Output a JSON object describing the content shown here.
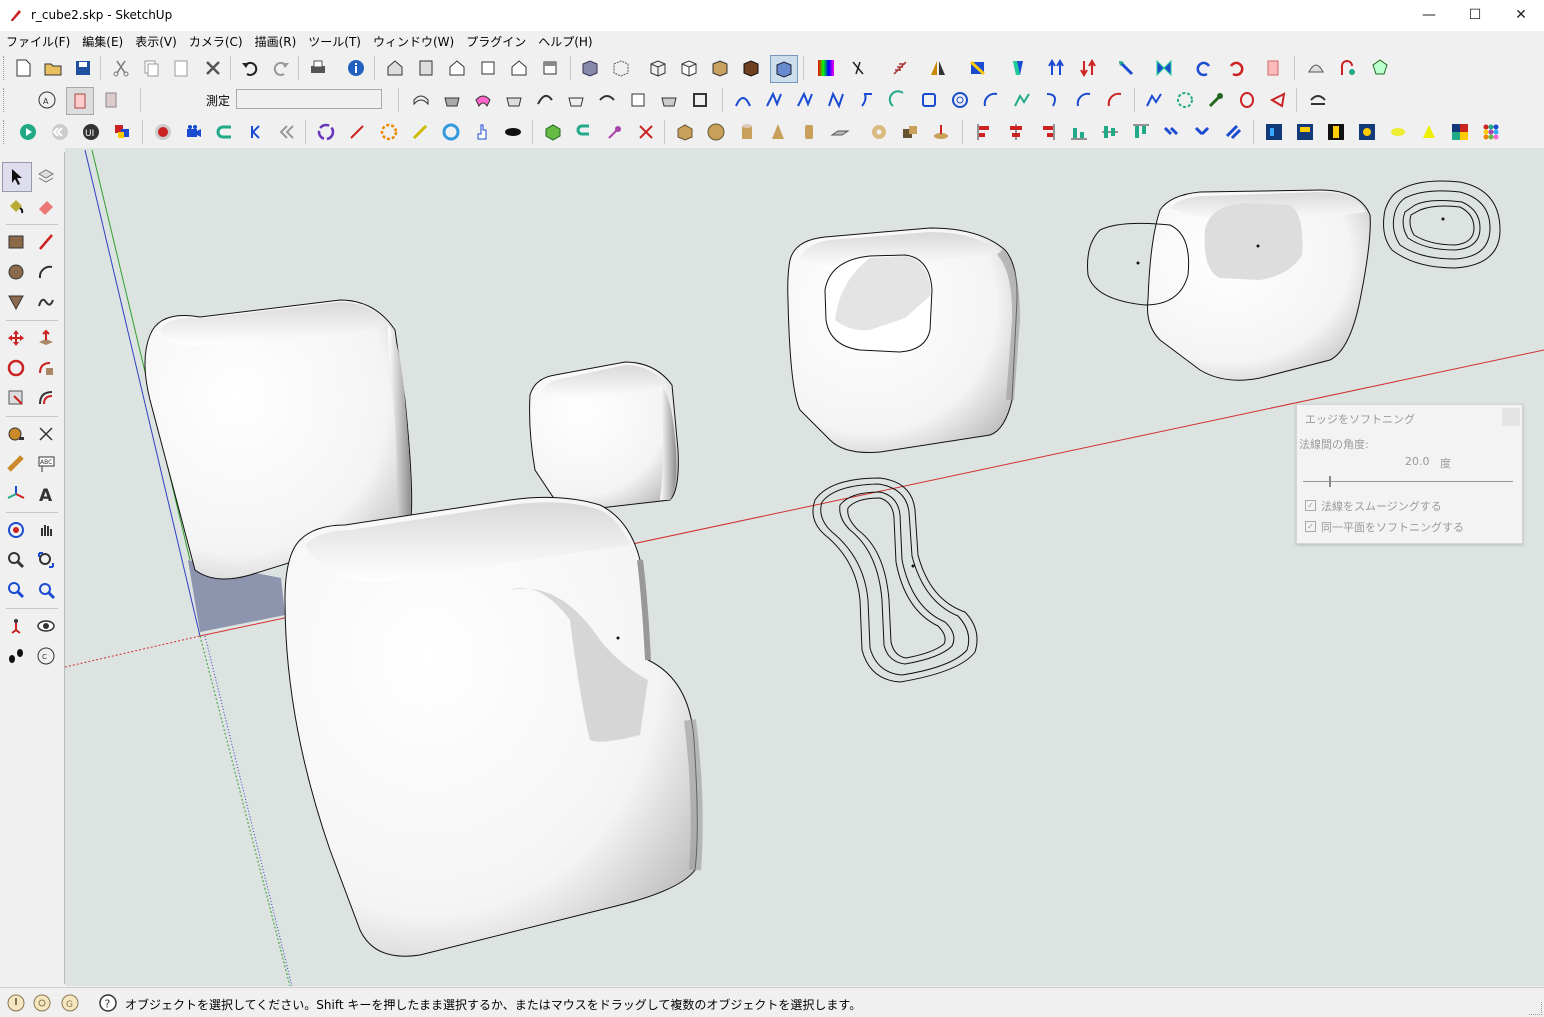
{
  "window": {
    "title": "r_cube2.skp - SketchUp",
    "minimize": "—",
    "maximize": "☐",
    "close": "✕"
  },
  "menu": [
    "ファイル(F)",
    "編集(E)",
    "表示(V)",
    "カメラ(C)",
    "描画(R)",
    "ツール(T)",
    "ウィンドウ(W)",
    "プラグイン",
    "ヘルプ(H)"
  ],
  "measure": {
    "label": "測定",
    "value": ""
  },
  "dialog": {
    "title": "エッジをソフトニング",
    "angle_label": "法線間の角度:",
    "angle_value": "20.0",
    "angle_unit": "度",
    "option1": "法線をスムージングする",
    "option2": "同一平面をソフトニングする",
    "option1_checked": true,
    "option2_checked": true
  },
  "status": {
    "message": "オブジェクトを選択してください。Shift キーを押したまま選択するか、またはマウスをドラッグして複数のオブジェクトを選択します。"
  },
  "colors": {
    "sky": "#dde3e1",
    "axis_red": "#d03030",
    "axis_green": "#30a030",
    "axis_blue": "#3040c0"
  }
}
